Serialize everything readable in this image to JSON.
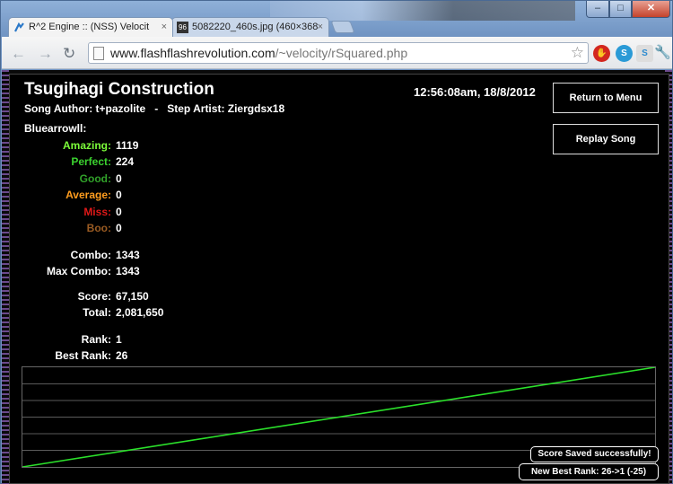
{
  "browser": {
    "tabs": [
      {
        "title": "R^2 Engine :: (NSS) Velocit",
        "close": "×"
      },
      {
        "title": "5082220_460s.jpg (460×368",
        "favicon_text": "96",
        "close": "×"
      }
    ],
    "window_controls": {
      "minimize": "–",
      "maximize": "□",
      "close": "✕"
    },
    "address": {
      "host": "www.flashflashrevolution.com",
      "path": "/~velocity/rSquared.php"
    },
    "extensions": [
      {
        "name": "adblock-icon",
        "glyph": "✋"
      },
      {
        "name": "skype-icon",
        "glyph": "S"
      },
      {
        "name": "skype-alt-icon",
        "glyph": "S"
      }
    ]
  },
  "game": {
    "song_title": "Tsugihagi Construction",
    "song_meta": "Song Author: t+pazolite   -   Step Artist: Ziergdsx18",
    "datetime": "12:56:08am, 18/8/2012",
    "buttons": {
      "menu": "Return to Menu",
      "replay": "Replay Song"
    },
    "player": "Bluearrowll:",
    "judgements": [
      {
        "label": "Amazing:",
        "value": "1119",
        "color": "#7cfc3a"
      },
      {
        "label": "Perfect:",
        "value": "224",
        "color": "#3bd22f"
      },
      {
        "label": "Good:",
        "value": "0",
        "color": "#31a22a"
      },
      {
        "label": "Average:",
        "value": "0",
        "color": "#ff9d1f"
      },
      {
        "label": "Miss:",
        "value": "0",
        "color": "#e01818"
      },
      {
        "label": "Boo:",
        "value": "0",
        "color": "#9a5b22"
      }
    ],
    "stats": [
      {
        "label": "Combo:",
        "value": "1343"
      },
      {
        "label": "Max Combo:",
        "value": "1343"
      },
      {
        "label": "Score:",
        "value": "67,150"
      },
      {
        "label": "Total:",
        "value": "2,081,650"
      },
      {
        "label": "Rank:",
        "value": "1"
      },
      {
        "label": "Best Rank:",
        "value": "26"
      }
    ],
    "graph": {
      "line_color": "#2be02b",
      "grid_color": "#5a5a5a",
      "progress_start": 0.0,
      "progress_end": 1.0
    },
    "toasts": {
      "saved": "Score Saved successfully!",
      "best": "New Best Rank: 26->1 (-25)"
    }
  }
}
